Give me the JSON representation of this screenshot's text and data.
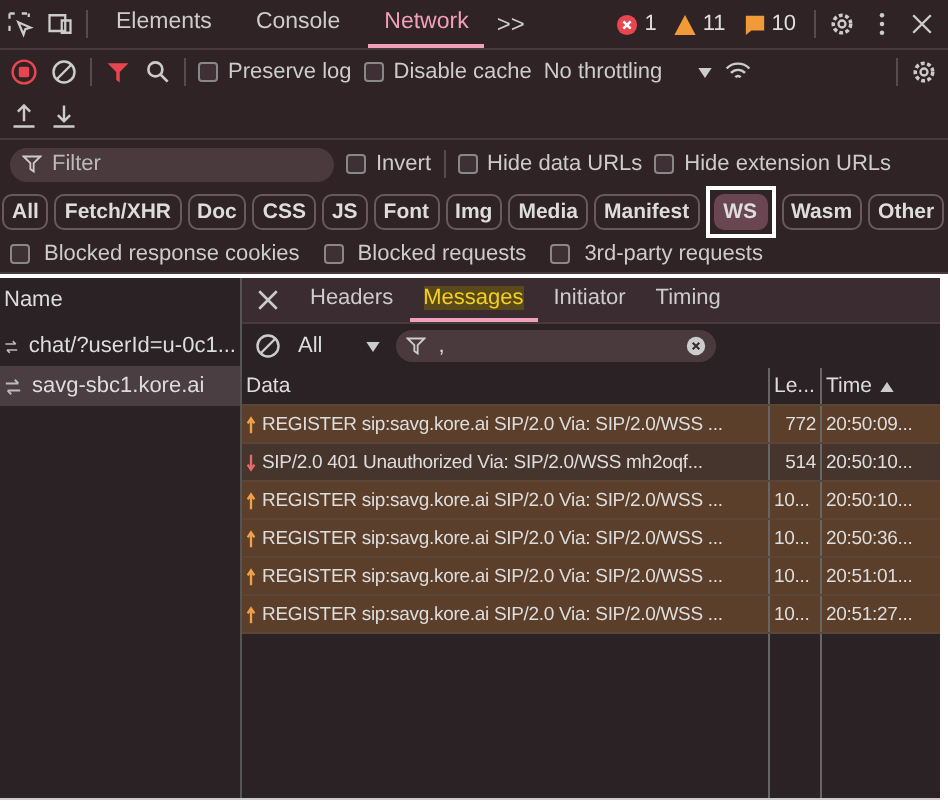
{
  "top_tabs": [
    {
      "label": "Elements",
      "selected": false
    },
    {
      "label": "Console",
      "selected": false
    },
    {
      "label": "Network",
      "selected": true
    }
  ],
  "overflow": ">>",
  "counts": {
    "errors": "1",
    "warnings": "11",
    "info": "10"
  },
  "toolbar": {
    "options": [
      {
        "label": "Preserve log",
        "checked": false
      },
      {
        "label": "Disable cache",
        "checked": false
      }
    ],
    "throttling": "No throttling"
  },
  "filter": {
    "placeholder": "Filter",
    "options": [
      {
        "label": "Invert",
        "checked": false
      },
      {
        "label": "Hide data URLs",
        "checked": false
      },
      {
        "label": "Hide extension URLs",
        "checked": false
      }
    ]
  },
  "types": [
    {
      "label": "All",
      "selected": false
    },
    {
      "label": "Fetch/XHR",
      "selected": false
    },
    {
      "label": "Doc",
      "selected": false
    },
    {
      "label": "CSS",
      "selected": false
    },
    {
      "label": "JS",
      "selected": false
    },
    {
      "label": "Font",
      "selected": false
    },
    {
      "label": "Img",
      "selected": false
    },
    {
      "label": "Media",
      "selected": false
    },
    {
      "label": "Manifest",
      "selected": false
    },
    {
      "label": "WS",
      "selected": true
    },
    {
      "label": "Wasm",
      "selected": false
    },
    {
      "label": "Other",
      "selected": false
    }
  ],
  "blocked_options": [
    {
      "label": "Blocked response cookies",
      "checked": false
    },
    {
      "label": "Blocked requests",
      "checked": false
    },
    {
      "label": "3rd-party requests",
      "checked": false
    }
  ],
  "requests": {
    "header": "Name",
    "items": [
      {
        "name": "chat/?userId=u-0c1...",
        "selected": false
      },
      {
        "name": "savg-sbc1.kore.ai",
        "selected": true
      }
    ]
  },
  "detail_tabs": [
    {
      "label": "Headers",
      "selected": false
    },
    {
      "label": "Messages",
      "selected": true
    },
    {
      "label": "Initiator",
      "selected": false
    },
    {
      "label": "Timing",
      "selected": false
    }
  ],
  "messages": {
    "filter_type": "All",
    "filter_value": ",",
    "columns": [
      "Data",
      "Le...",
      "Time"
    ],
    "rows": [
      {
        "kind": "sent",
        "data": "REGISTER sip:savg.kore.ai SIP/2.0 Via: SIP/2.0/WSS ...",
        "length": "772",
        "time": "20:50:09..."
      },
      {
        "kind": "received",
        "data": "SIP/2.0 401 Unauthorized Via: SIP/2.0/WSS mh2oqf...",
        "length": "514",
        "time": "20:50:10..."
      },
      {
        "kind": "sent",
        "data": "REGISTER sip:savg.kore.ai SIP/2.0 Via: SIP/2.0/WSS ...",
        "length": "10...",
        "time": "20:50:10..."
      },
      {
        "kind": "sent",
        "data": "REGISTER sip:savg.kore.ai SIP/2.0 Via: SIP/2.0/WSS ...",
        "length": "10...",
        "time": "20:50:36..."
      },
      {
        "kind": "sent",
        "data": "REGISTER sip:savg.kore.ai SIP/2.0 Via: SIP/2.0/WSS ...",
        "length": "10...",
        "time": "20:51:01..."
      },
      {
        "kind": "sent",
        "data": "REGISTER sip:savg.kore.ai SIP/2.0 Via: SIP/2.0/WSS ...",
        "length": "10...",
        "time": "20:51:27..."
      }
    ]
  }
}
